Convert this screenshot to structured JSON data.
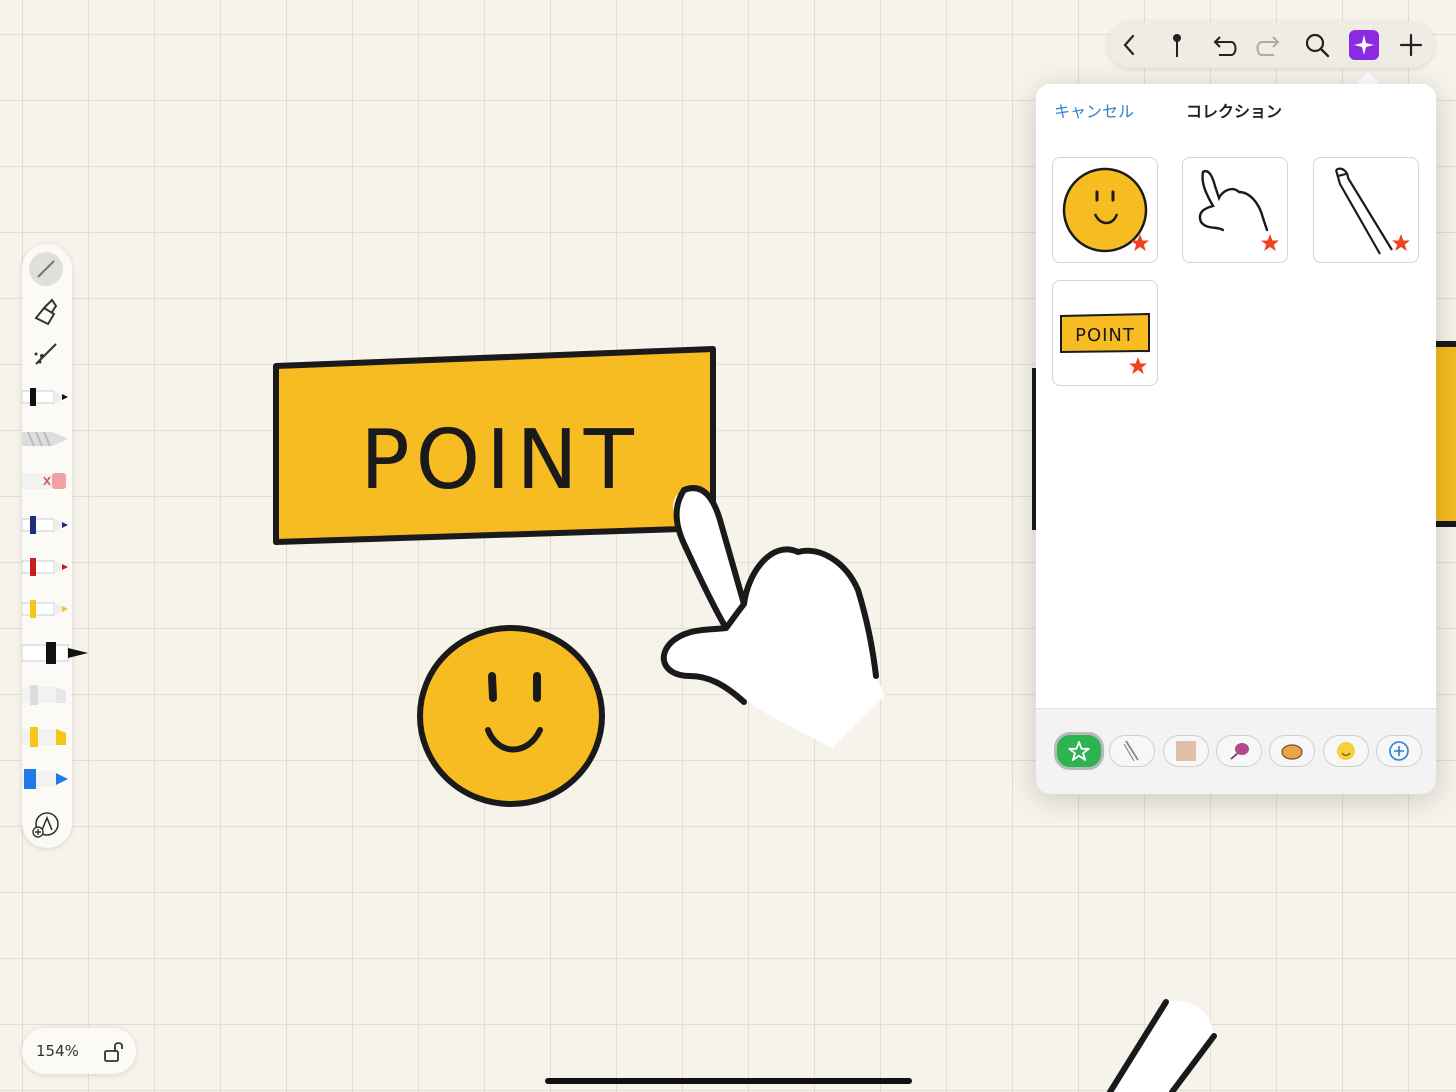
{
  "popover": {
    "cancel_label": "キャンセル",
    "title": "コレクション",
    "thumb_point_text": "POINT"
  },
  "canvas": {
    "sign_text": "POINT"
  },
  "zoom": {
    "label": "154%"
  },
  "colors": {
    "yellow": "#f6bc22",
    "accent_blue": "#2f7fd1",
    "accent_purple": "#8a2be2",
    "star_red": "#f0421e",
    "active_green": "#2db34f"
  },
  "toolbar_icons": [
    "chevron-left-icon",
    "pin-icon",
    "undo-icon",
    "redo-icon",
    "search-icon",
    "sparkle-icon",
    "plus-icon"
  ],
  "palette_icons": [
    "pen-tool",
    "fill-tool",
    "lasso-tool",
    "black-pen",
    "pencil",
    "eraser",
    "navy-pen",
    "red-pen",
    "yellow-pen",
    "black-marker",
    "gray-marker",
    "yellow-highlighter",
    "blue-highlighter",
    "add-tool"
  ]
}
